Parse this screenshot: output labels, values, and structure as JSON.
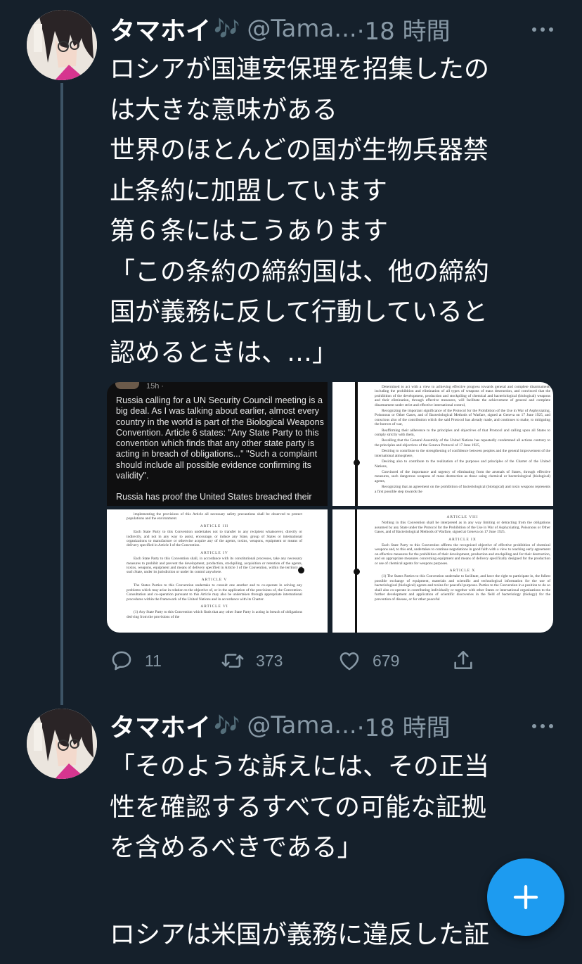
{
  "tweets": [
    {
      "name": "タマホイ",
      "emoji": "🎶",
      "handle": "@Tama...",
      "time": "·18 時間",
      "text_lines": [
        "ロシアが国連安保理を招集したの",
        "は大きな意味がある",
        "世界のほとんどの国が生物兵器禁",
        "止条約に加盟しています",
        "第６条にはこうあります",
        "「この条約の締約国は、他の締約",
        "国が義務に反して行動していると",
        "認めるときは、…」"
      ],
      "media": {
        "screenshot_time": "15h · ",
        "screenshot_text": "Russia calling for a UN Security Council meeting is a big deal. As I was talking about earlier, almost every country in the world is part of the Biological Weapons Convention. Article 6 states: \"Any State Party to this convention which finds that any other state party is acting in breach of obligations...\" \"Such a complaint should include all possible evidence confirming its validity\".",
        "screenshot_text_2": "Russia has proof the United States breached their",
        "doc_top_right": [
          "Determined to act with a view to achieving effective progress towards general and complete disarmament, including the prohibition and elimination of all types of weapons of mass destruction, and convinced that the prohibition of the development, production and stockpiling of chemical and bacteriological (biological) weapons and their elimination, through effective measures, will facilitate the achievement of general and complete disarmament under strict and effective international control,",
          "Recognizing the important significance of the Protocol for the Prohibition of the Use in War of Asphyxiating, Poisonous or Other Gases, and of Bacteriological Methods of Warfare, signed at Geneva on 17 June 1925, and conscious also of the contribution which the said Protocol has already made, and continues to make, to mitigating the horrors of war,",
          "Reaffirming their adherence to the principles and objectives of that Protocol and calling upon all States to comply strictly with them,",
          "Recalling that the General Assembly of the United Nations has repeatedly condemned all actions contrary to the principles and objectives of the Geneva Protocol of 17 June 1925,",
          "Desiring to contribute to the strengthening of confidence between peoples and the general improvement of the international atmosphere,",
          "Desiring also to contribute to the realization of the purposes and principles of the Charter of the United Nations,",
          "Convinced of the importance and urgency of eliminating from the arsenals of States, through effective measures, such dangerous weapons of mass destruction as those using chemical or bacteriological (biological) agents,",
          "Recognizing that an agreement on the prohibition of bacteriological (biological) and toxin weapons represents a first possible step towards the"
        ],
        "doc_bottom_left": [
          "implementing the provisions of this Article all necessary safety precautions shall be observed to protect populations and the environment.",
          "ARTICLE III",
          "Each State Party to this Convention undertakes not to transfer to any recipient whatsoever, directly or indirectly, and not in any way to assist, encourage, or induce any State, group of States or international organizations to manufacture or otherwise acquire any of the agents, toxins, weapons, equipment or means of delivery specified in Article I of the Convention.",
          "ARTICLE IV",
          "Each State Party to this Convention shall, in accordance with its constitutional processes, take any necessary measures to prohibit and prevent the development, production, stockpiling, acquisition or retention of the agents, toxins, weapons, equipment and means of delivery specified in Article I of the Convention, within the territory of such State, under its jurisdiction or under its control anywhere.",
          "ARTICLE V",
          "The States Parties to this Convention undertake to consult one another and to co-operate in solving any problems which may arise in relation to the objective of, or in the application of the provisions of, the Convention. Consultation and co-operation pursuant to this Article may also be undertaken through appropriate international procedures within the framework of the United Nations and in accordance with its Charter.",
          "ARTICLE VI",
          "(1) Any State Party to this Convention which finds that any other State Party is acting in breach of obligations deriving from the provisions of the"
        ],
        "doc_bottom_right": [
          "ARTICLE VIII",
          "Nothing in this Convention shall be interpreted as in any way limiting or detracting from the obligations assumed by any State under the Protocol for the Prohibition of the Use in War of Asphyxiating, Poisonous or Other Gases, and of Bacteriological Methods of Warfare, signed at Geneva on 17 June 1925.",
          "ARTICLE IX",
          "Each State Party to this Convention affirms the recognized objective of effective prohibition of chemical weapons and, to this end, undertakes to continue negotiations in good faith with a view to reaching early agreement on effective measures for the prohibition of their development, production and stockpiling and for their destruction, and on appropriate measures concerning equipment and means of delivery specifically designed for the production or use of chemical agents for weapons purposes.",
          "ARTICLE X",
          "(1) The States Parties to this Convention undertake to facilitate, and have the right to participate in, the fullest possible exchange of equipment, materials and scientific and technological information for the use of bacteriological (biological) agents and toxins for peaceful purposes. Parties to the Convention in a position to do so shall also co-operate in contributing individually or together with other States or international organizations to the further development and application of scientific discoveries in the field of bacteriology (biology) for the prevention of disease, or for other peaceful"
        ]
      },
      "actions": {
        "replies": "11",
        "retweets": "373",
        "likes": "679"
      }
    },
    {
      "name": "タマホイ",
      "emoji": "🎶",
      "handle": "@Tama...",
      "time": "·18 時間",
      "text_lines": [
        "「そのような訴えには、その正当",
        "性を確認するすべての可能な証拠",
        "を含めるべきである」"
      ],
      "partial_line": "ロシアは米国が義務に違反した証"
    }
  ],
  "icons": {
    "reply": "reply-icon",
    "retweet": "retweet-icon",
    "like": "heart-icon",
    "share": "share-icon",
    "compose": "plus-icon",
    "more": "more-icon"
  },
  "colors": {
    "background": "#15202b",
    "secondary_text": "#8899a6",
    "accent": "#1d9bf0",
    "thread_line": "#3d5466"
  }
}
